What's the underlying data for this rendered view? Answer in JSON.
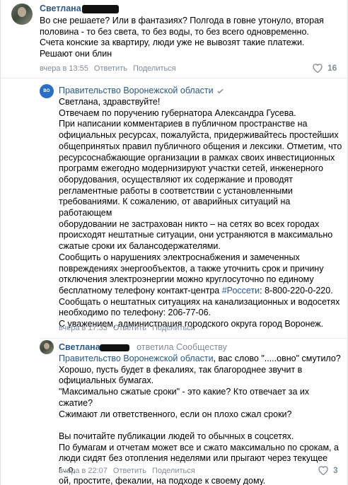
{
  "comments": [
    {
      "author": "Светлана",
      "text": "Во сне решаете? Или в фантазиях? Полгода в говне утонуло, вторая\nполовина - то без света, то без воды, то без всего одновременно.\nСчета конские за квартиру, люди уже не вывозят такие платежи.\nРешают они блин",
      "time": "вчера в 13:55",
      "reply": "Ответить",
      "share": "Поделиться",
      "likes": "16"
    },
    {
      "author": "Правительство Воронежской области",
      "avatar_text": "ВО",
      "text_1": "Светлана, здравствуйте!\nОтвечаем по поручению губернатора Александра Гусева.\nПри написании комментариев в публичном пространстве на\nофициальных ресурсах, пожалуйста, придерживайтесь простейших\nобщепринятых правил публичного общения и лексики. Отметим, что\nресурсоснабжающие организации в рамках своих инвестиционных\nпрограмм ежегодно модернизируют участки сетей, инженерного\nоборудования, осуществляют их содержание и проводят\nрегламентные работы в соответствии с установленными\nтребованиями. К сожалению, от аварийных ситуаций на работающем\nоборудовании не застрахован никто – на сетях во всех городах\nпроисходят нештатные ситуации, они устраняются в максимально\nсжатые сроки их балансодержателями.\nСообщить о нарушениях электроснабжения и замеченных\nповреждениях энергообъектов, а также уточнить срок и причину\nотключения электроэнергии можно круглосуточно по единому\nбесплатному телефону контакт-центра ",
      "hashtag": "#Россети",
      "text_2": ": 8-800-220-0-220.\nСообщать о нештатных ситуациях на канализационных и водосетях\nнеобходимо по телефону: 206-77-06.\nС уважением, администрация городского округа город Воронеж.",
      "time": "вчера в 17:33",
      "reply": "Ответить",
      "share": "Поделиться"
    },
    {
      "author": "Светлана",
      "reply_to": "ответила Сообществу",
      "mention": "Правительство Воронежской области",
      "text": ", вас слово \".....овно\" смутило?\nХорошо, пусть будет в фекалиях, так благороднее звучит в\nофициальных бумагах.\n\"Максимально сжатые сроки\" - это какие? Кто отвечает за их сжатие?\nСжимают ли ответственного, если он плохо сжал сроки?\n\nВы почитайте публикации людей то обычных в соцсетях.\nПо бумагам и отчетам может все и сжато максимально по срокам, а\nлюди сидят без отопления неделями или прыгают через текущее г...о,\nой, простите, фекалии, на подходе к своему дому.",
      "time": "вчера в 22:07",
      "reply": "Ответить",
      "share": "Поделиться",
      "likes": "3"
    }
  ],
  "colors": {
    "link": "#2a5885",
    "meta": "#818c99",
    "gov_avatar": "#2b6fc2"
  }
}
